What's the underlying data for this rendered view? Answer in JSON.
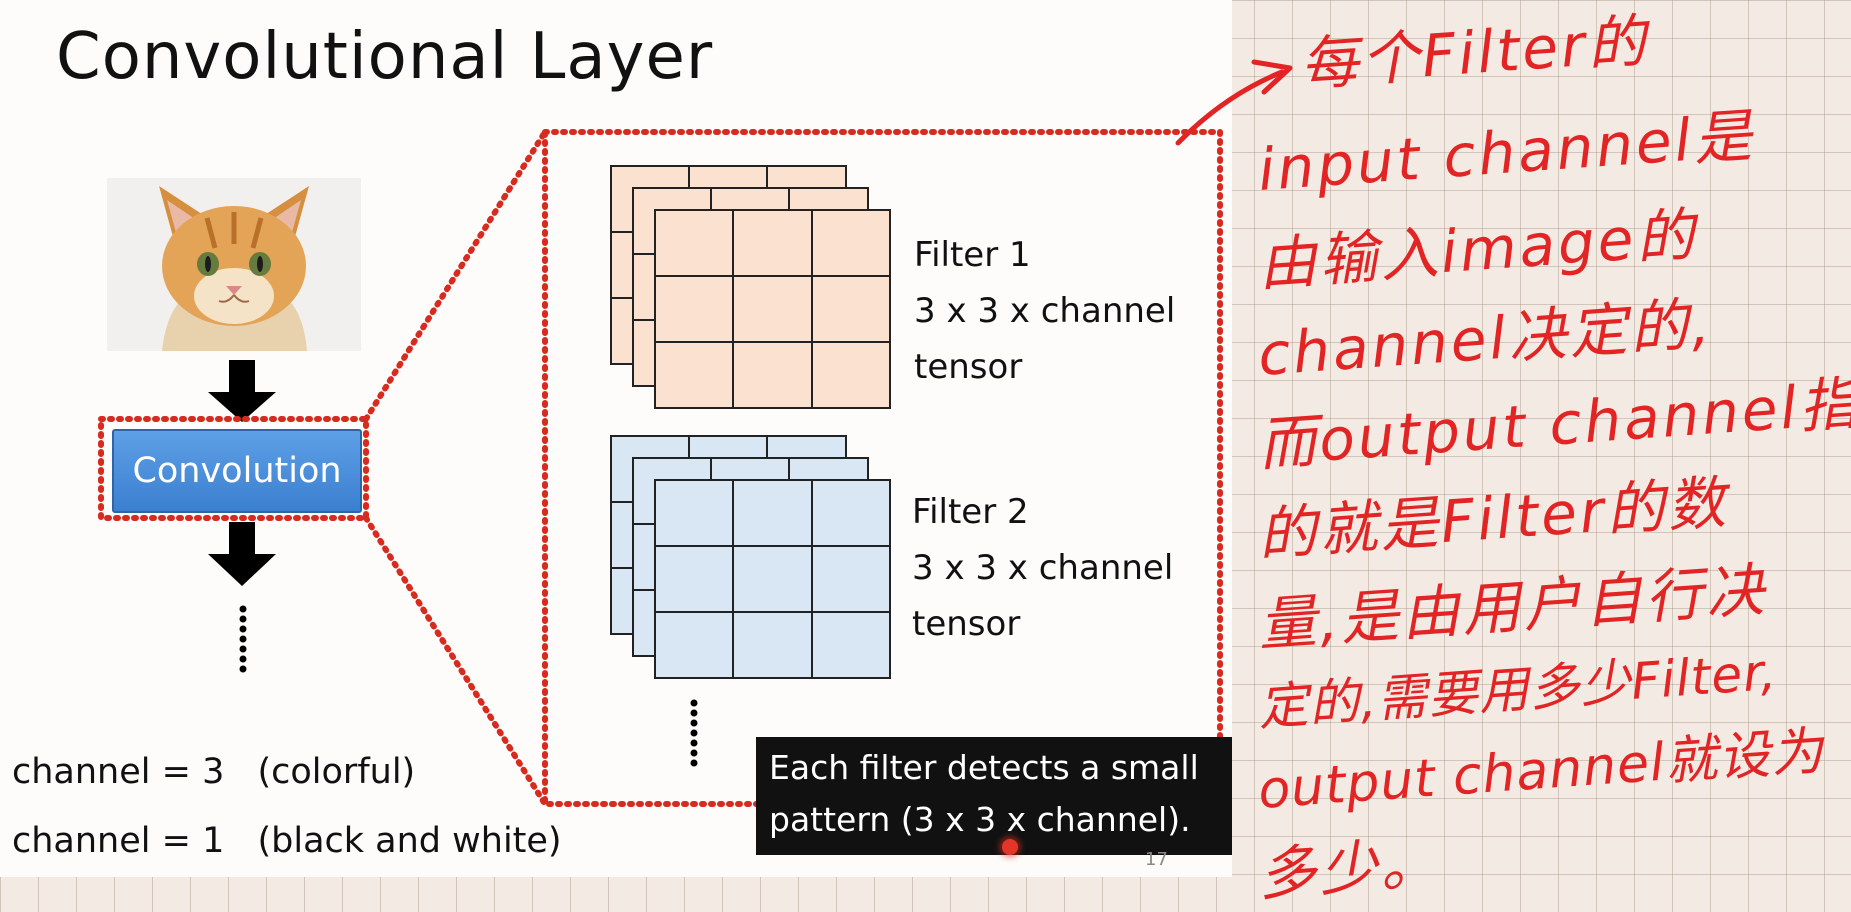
{
  "slide": {
    "title": "Convolutional Layer",
    "convolution_button": "Convolution",
    "filters": [
      {
        "name": "Filter 1",
        "size": "3 x 3 x channel",
        "kind": "tensor",
        "color": "#fbe2d0"
      },
      {
        "name": "Filter 2",
        "size": "3 x 3 x channel",
        "kind": "tensor",
        "color": "#d9e7f4"
      }
    ],
    "channel_lines": [
      {
        "equation": "channel = 3",
        "note": "(colorful)"
      },
      {
        "equation": "channel = 1",
        "note": "(black and white)"
      }
    ],
    "caption": {
      "line1": "Each filter detects a small",
      "line2": "pattern (3 x 3 x channel)."
    },
    "page_number": "17",
    "accent_red": "#d62b1e",
    "button_blue": "#4a8fdc"
  },
  "handwritten_note": {
    "color": "#e22424",
    "lines": [
      "每个Filter的",
      "input channel是",
      "由输入image的",
      "channel决定的,",
      "而output channel指",
      "的就是Filter的数",
      "量,是由用户自行决",
      "定的,需要用多少Filter,",
      "output channel就设为",
      "多少。"
    ]
  }
}
